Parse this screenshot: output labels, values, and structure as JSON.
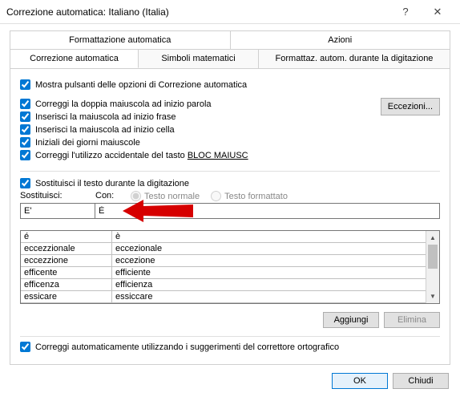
{
  "titlebar": {
    "title": "Correzione automatica: Italiano (Italia)"
  },
  "tabs": {
    "row1": {
      "formatting": "Formattazione automatica",
      "actions": "Azioni"
    },
    "row2": {
      "autocorrect": "Correzione automatica",
      "mathsymbols": "Simboli matematici",
      "formattyping": "Formattaz. autom. durante la digitazione"
    }
  },
  "checkboxes": {
    "show_buttons": "Mostra pulsanti delle opzioni di Correzione automatica",
    "two_initial": "Correggi la doppia maiuscola ad inizio parola",
    "cap_sentence": "Inserisci la maiuscola ad inizio frase",
    "cap_cell": "Inserisci la maiuscola ad inizio cella",
    "day_names": "Iniziali dei giorni maiuscole",
    "caps_lock_pre": "Correggi l'utilizzo accidentale del tasto ",
    "caps_lock_key": "BLOC MAIUSC",
    "replace_typing": "Sostituisci il testo durante la digitazione",
    "auto_suggest": "Correggi automaticamente utilizzando i suggerimenti del correttore ortografico"
  },
  "buttons": {
    "exceptions": "Eccezioni...",
    "add": "Aggiungi",
    "delete": "Elimina",
    "ok": "OK",
    "close": "Chiudi"
  },
  "replace": {
    "col1": "Sostituisci:",
    "col2": "Con:",
    "radio_plain": "Testo normale",
    "radio_formatted": "Testo formattato",
    "input_from": "E'",
    "input_to": "È"
  },
  "table": [
    {
      "from": "é",
      "to": "è"
    },
    {
      "from": "eccezzionale",
      "to": "eccezionale"
    },
    {
      "from": "eccezzione",
      "to": "eccezione"
    },
    {
      "from": "efficente",
      "to": "efficiente"
    },
    {
      "from": "efficenza",
      "to": "efficienza"
    },
    {
      "from": "essicare",
      "to": "essiccare"
    }
  ]
}
